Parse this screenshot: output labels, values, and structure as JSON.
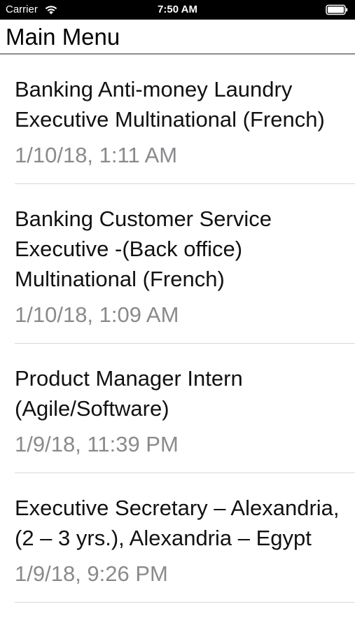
{
  "status_bar": {
    "carrier": "Carrier",
    "time": "7:50 AM",
    "wifi_icon": "wifi-icon",
    "battery_icon": "battery-icon"
  },
  "nav": {
    "title": "Main Menu"
  },
  "list": {
    "items": [
      {
        "title": "Banking Anti-money Laundry Executive Multinational (French)",
        "date": "1/10/18, 1:11 AM"
      },
      {
        "title": "Banking Customer Service Executive -(Back office) Multinational (French)",
        "date": "1/10/18, 1:09 AM"
      },
      {
        "title": "Product Manager Intern (Agile/Software)",
        "date": "1/9/18, 11:39 PM"
      },
      {
        "title": "Executive Secretary – Alexandria, (2 – 3 yrs.), Alexandria – Egypt",
        "date": "1/9/18, 9:26 PM"
      }
    ]
  },
  "colors": {
    "status_bar_bg": "#000000",
    "title_text": "#111111",
    "date_text": "#8a8a8e",
    "divider": "#d9d9dc"
  }
}
